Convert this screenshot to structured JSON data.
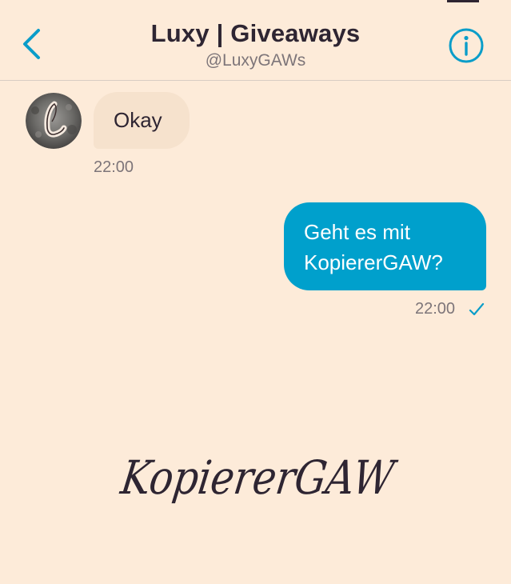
{
  "header": {
    "title": "Luxy | Giveaways",
    "handle": "@LuxyGAWs",
    "back_icon": "chevron-left-icon",
    "info_icon": "info-icon"
  },
  "conversation": {
    "messages": [
      {
        "direction": "incoming",
        "text": "Okay",
        "time": "22:00"
      },
      {
        "direction": "outgoing",
        "lines": [
          "Geht es mit",
          "KopiererGAW?"
        ],
        "time": "22:00",
        "status_icon": "checkmark-icon"
      }
    ]
  },
  "watermark": {
    "text": "KopiererGAW"
  },
  "colors": {
    "background": "#fdebd9",
    "accent": "#0a9dc9",
    "outgoing_bubble": "#00a0cc",
    "incoming_bubble": "#f6e2cd",
    "text_dark": "#2e2532",
    "text_muted": "#7d7579"
  }
}
